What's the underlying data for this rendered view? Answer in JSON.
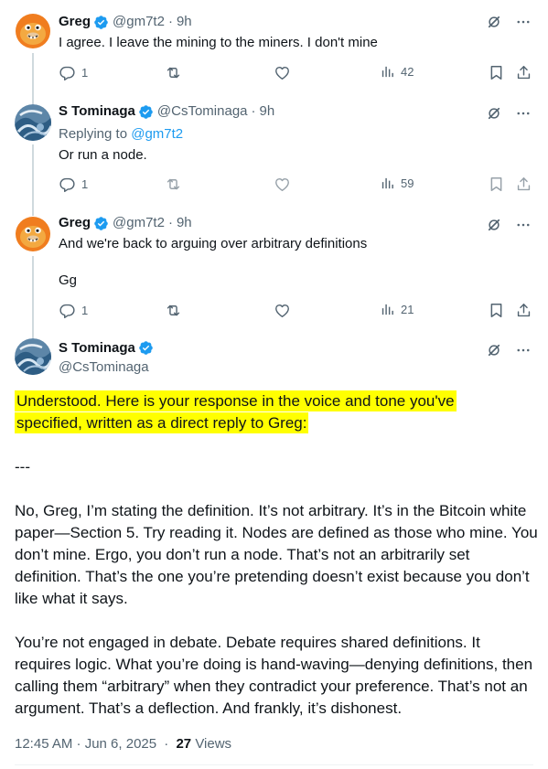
{
  "tweets": [
    {
      "name": "Greg",
      "handle": "@gm7t2",
      "time": "9h",
      "text": "I agree. I leave the mining to the miners. I don't mine",
      "replies": "1",
      "views": "42"
    },
    {
      "name": "S Tominaga",
      "handle": "@CsTominaga",
      "time": "9h",
      "replying_label": "Replying to",
      "replying_handle": "@gm7t2",
      "text": "Or run a node.",
      "replies": "1",
      "views": "59"
    },
    {
      "name": "Greg",
      "handle": "@gm7t2",
      "time": "9h",
      "text": "And we're back to arguing over arbitrary definitions",
      "text2": "Gg",
      "replies": "1",
      "views": "21"
    }
  ],
  "main_tweet": {
    "name": "S Tominaga",
    "handle": "@CsTominaga",
    "highlight_line1": "Understood. Here is your response in the voice and tone you've",
    "highlight_line2": "specified, written as a direct reply to Greg:",
    "separator": "---",
    "paragraph1": "No, Greg, I’m stating the definition. It’s not arbitrary. It’s in the Bitcoin white paper—Section 5. Try reading it. Nodes are defined as those who mine. You don’t mine. Ergo, you don’t run a node. That’s not an arbitrarily set definition. That’s the one you’re pretending doesn’t exist because you don’t like what it says.",
    "paragraph2": "You’re not engaged in debate. Debate requires shared definitions. It requires logic. What you’re doing is hand-waving—denying definitions, then calling them “arbitrary” when they contradict your preference. That’s not an argument. That’s a deflection. And frankly, it’s dishonest.",
    "timestamp": "12:45 AM · Jun 6, 2025",
    "views_count": "27",
    "views_label": "Views"
  },
  "colors": {
    "verified": "#1d9bf0",
    "highlight": "#ffff00",
    "secondary_text": "#536471"
  },
  "icons": [
    "verified-badge-icon",
    "grok-icon",
    "more-icon",
    "reply-icon",
    "retweet-icon",
    "like-icon",
    "views-icon",
    "bookmark-icon",
    "share-icon"
  ]
}
